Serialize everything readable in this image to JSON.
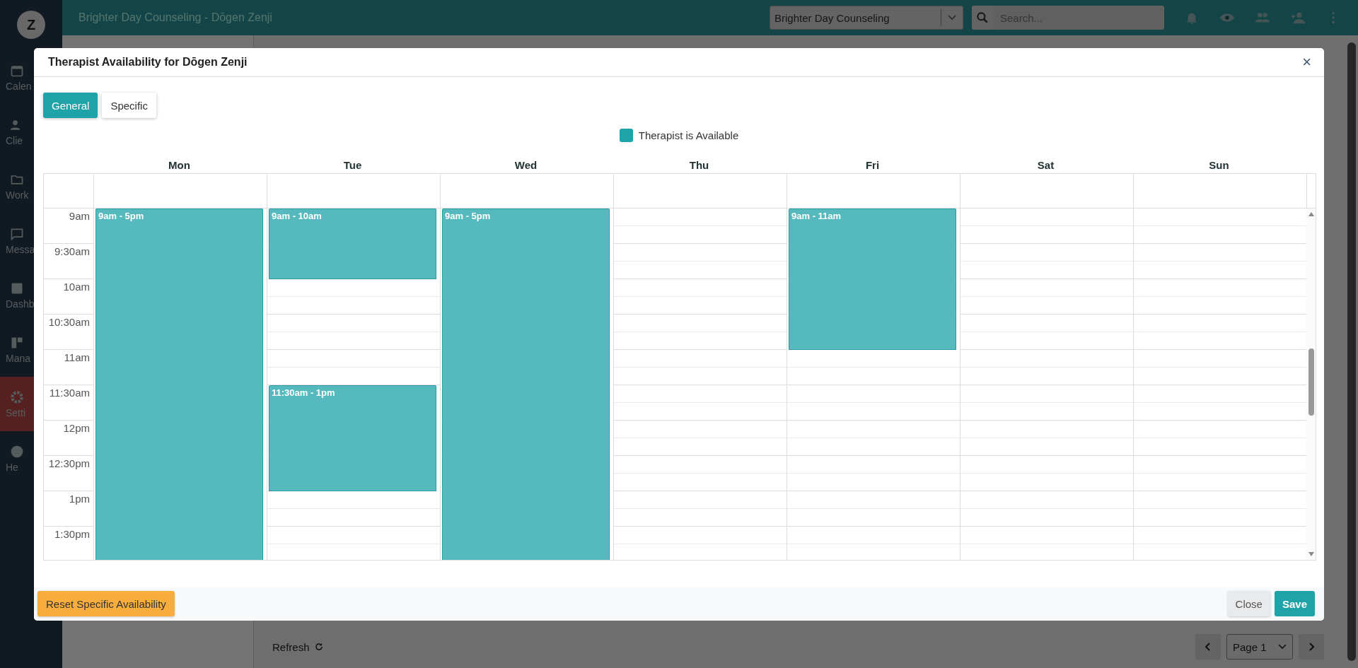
{
  "app": {
    "avatar": "Z",
    "title": "Brighter Day Counseling - Dōgen Zenji",
    "organization": "Brighter Day Counseling",
    "search_placeholder": "Search...",
    "sidebar": [
      {
        "label": "Calen",
        "kind": "calendar",
        "selected": false
      },
      {
        "label": "Clie",
        "kind": "people",
        "selected": false
      },
      {
        "label": "Work",
        "kind": "folder",
        "selected": false
      },
      {
        "label": "Messa",
        "kind": "message",
        "selected": false
      },
      {
        "label": "Dashb",
        "kind": "chart",
        "selected": false
      },
      {
        "label": "Mana",
        "kind": "panel",
        "selected": false
      },
      {
        "label": "Setti",
        "kind": "gear",
        "selected": true
      },
      {
        "label": "He",
        "kind": "help",
        "selected": false
      }
    ],
    "refresh": "Refresh",
    "page": "Page 1"
  },
  "dialog": {
    "title": "Therapist Availability for Dōgen Zenji",
    "close": "×",
    "tabs": [
      {
        "label": "General",
        "selected": true
      },
      {
        "label": "Specific",
        "selected": false
      }
    ],
    "legend": {
      "label": "Therapist is Available",
      "color": "#20a3a8"
    },
    "times": [
      "9am",
      "9:30am",
      "10am",
      "10:30am",
      "11am",
      "11:30am",
      "12pm",
      "12:30pm",
      "1pm",
      "1:30pm"
    ],
    "days": [
      {
        "name": "Mon",
        "slots": [
          {
            "available": true,
            "label": "9am - 5pm"
          },
          {
            "available": true
          },
          {
            "available": true
          },
          {
            "available": true
          },
          {
            "available": true
          },
          {
            "available": true
          },
          {
            "available": true
          },
          {
            "available": true
          },
          {
            "available": true
          },
          {
            "available": true
          }
        ]
      },
      {
        "name": "Tue",
        "slots": [
          {
            "available": true,
            "label": "9am - 10am"
          },
          {
            "available": true
          },
          {
            "available": false
          },
          {
            "available": false
          },
          {
            "available": false
          },
          {
            "available": true,
            "label": "11:30am - 1pm"
          },
          {
            "available": true
          },
          {
            "available": true
          },
          {
            "available": false
          },
          {
            "available": false
          }
        ]
      },
      {
        "name": "Wed",
        "slots": [
          {
            "available": true,
            "label": "9am - 5pm"
          },
          {
            "available": true
          },
          {
            "available": true
          },
          {
            "available": true
          },
          {
            "available": true
          },
          {
            "available": true
          },
          {
            "available": true
          },
          {
            "available": true
          },
          {
            "available": true
          },
          {
            "available": true
          }
        ]
      },
      {
        "name": "Thu",
        "slots": [
          {
            "available": false
          },
          {
            "available": false
          },
          {
            "available": false
          },
          {
            "available": false
          },
          {
            "available": false
          },
          {
            "available": false
          },
          {
            "available": false
          },
          {
            "available": false
          },
          {
            "available": false
          },
          {
            "available": false
          }
        ]
      },
      {
        "name": "Fri",
        "slots": [
          {
            "available": true,
            "label": "9am - 11am"
          },
          {
            "available": true
          },
          {
            "available": true
          },
          {
            "available": true
          },
          {
            "available": false
          },
          {
            "available": false
          },
          {
            "available": false
          },
          {
            "available": false
          },
          {
            "available": false
          },
          {
            "available": false
          }
        ]
      },
      {
        "name": "Sat",
        "slots": [
          {
            "available": false
          },
          {
            "available": false
          },
          {
            "available": false
          },
          {
            "available": false
          },
          {
            "available": false
          },
          {
            "available": false
          },
          {
            "available": false
          },
          {
            "available": false
          },
          {
            "available": false
          },
          {
            "available": false
          }
        ]
      },
      {
        "name": "Sun",
        "slots": [
          {
            "available": false
          },
          {
            "available": false
          },
          {
            "available": false
          },
          {
            "available": false
          },
          {
            "available": false
          },
          {
            "available": false
          },
          {
            "available": false
          },
          {
            "available": false
          },
          {
            "available": false
          },
          {
            "available": false
          }
        ]
      }
    ],
    "reset": "Reset Specific Availability",
    "buttons": [
      {
        "label": "Close",
        "kind": "secondary"
      },
      {
        "label": "Save",
        "kind": "primary"
      }
    ]
  }
}
